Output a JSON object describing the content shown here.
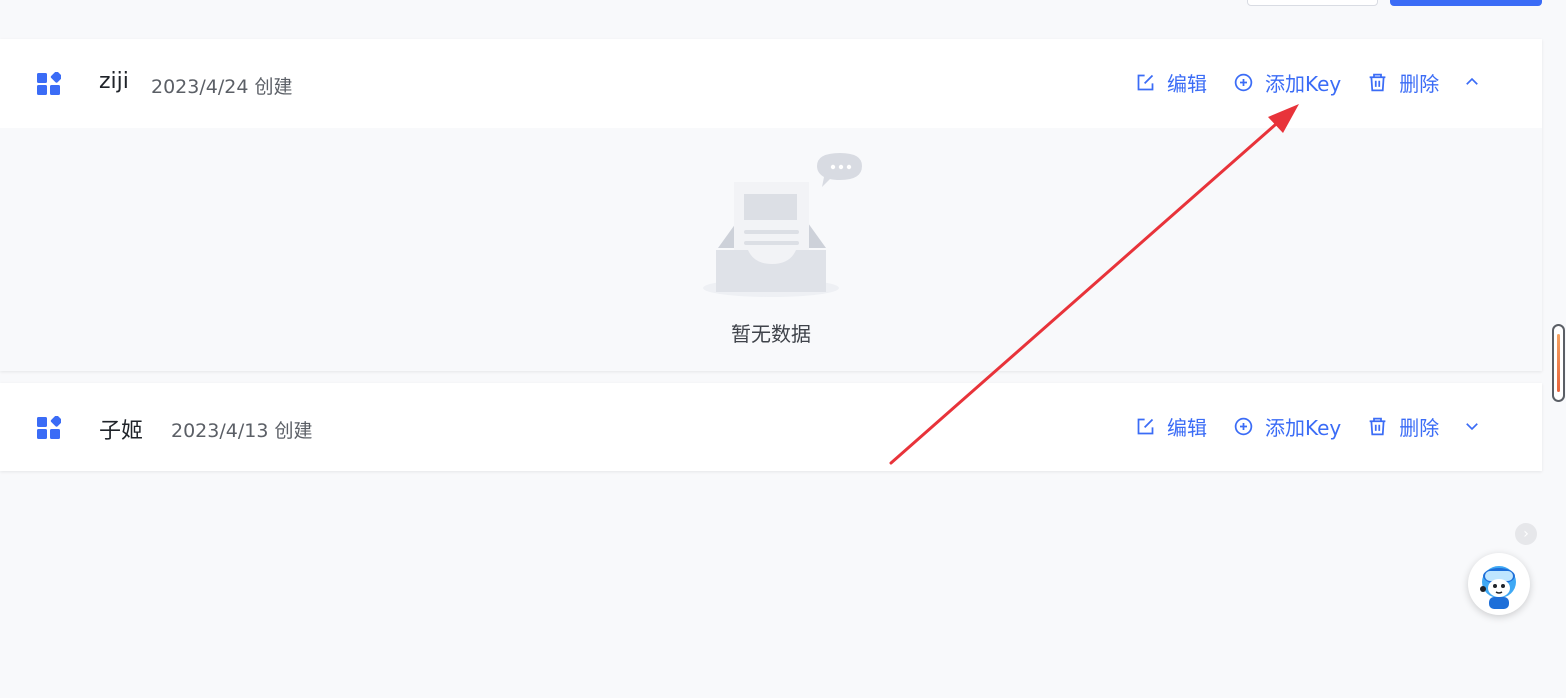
{
  "colors": {
    "accent": "#3b6cf6",
    "annotation": "#e8333a"
  },
  "items": [
    {
      "name": "ziji",
      "created": "2023/4/24 创建",
      "expanded": true,
      "actions": {
        "edit": "编辑",
        "add_key": "添加Key",
        "delete": "删除"
      },
      "empty_text": "暂无数据"
    },
    {
      "name": "子姬",
      "created": "2023/4/13 创建",
      "expanded": false,
      "actions": {
        "edit": "编辑",
        "add_key": "添加Key",
        "delete": "删除"
      }
    }
  ],
  "icons": {
    "app": "apps-icon",
    "edit": "edit-icon",
    "add": "plus-circle-icon",
    "delete": "trash-icon",
    "expand_up": "chevron-up-icon",
    "expand_down": "chevron-down-icon",
    "empty": "empty-box-icon",
    "assistant": "assistant-avatar-icon",
    "collapse": "chevron-right-icon"
  }
}
